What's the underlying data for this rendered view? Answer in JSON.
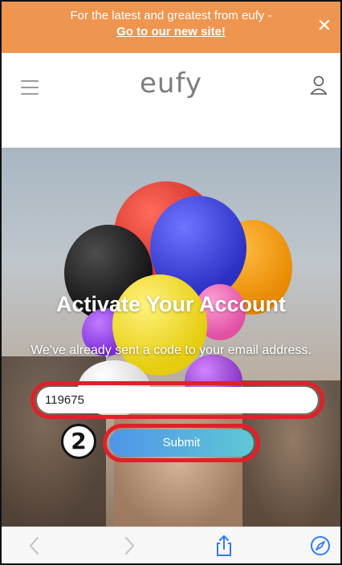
{
  "promo": {
    "text": "For the latest and greatest from eufy -",
    "link": "Go to our new site!",
    "close": "✕"
  },
  "header": {
    "logo": "eufy",
    "menu_icon": "hamburger-menu-icon",
    "user_icon": "user-account-icon"
  },
  "hero": {
    "title": "Activate Your Account",
    "subtitle": "We've already sent a code to your email address.",
    "code_value": "119675",
    "submit_label": "Submit",
    "step_badge": "2"
  },
  "toolbar": {
    "icons": [
      "back-arrow-icon",
      "forward-arrow-icon",
      "share-icon",
      "compass-icon"
    ]
  },
  "colors": {
    "promo_bg": "#ee9550",
    "highlight": "#e0202a",
    "submit_start": "#4f95e8",
    "submit_end": "#5fc8d6",
    "toolbar_icon": "#2f7bf5"
  }
}
